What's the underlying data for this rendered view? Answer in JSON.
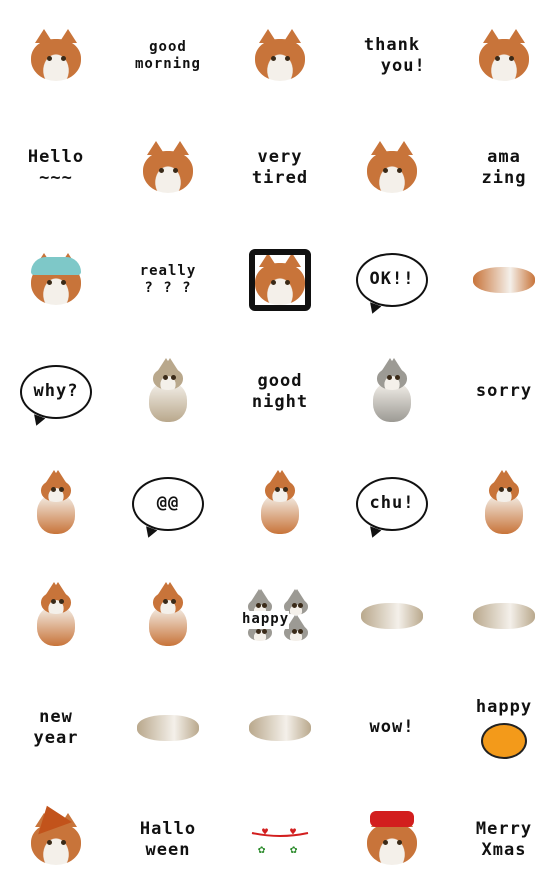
{
  "colors": {
    "orange": "#c8743a",
    "white": "#f4f0ea",
    "tabby": "#b9a88c",
    "grey": "#9c9a94",
    "pumpkin": "#f39a1a",
    "bow": "#d21e1e"
  },
  "cells": [
    {
      "type": "cat",
      "variant": "head",
      "color": "orange"
    },
    {
      "type": "text",
      "text": "good\nmorning",
      "small": true
    },
    {
      "type": "cat",
      "variant": "head",
      "color": "orange"
    },
    {
      "type": "text",
      "text": "thank\n  you!"
    },
    {
      "type": "cat",
      "variant": "head",
      "color": "orange"
    },
    {
      "type": "text",
      "text": "Hello\n~~~"
    },
    {
      "type": "cat",
      "variant": "head",
      "color": "orange"
    },
    {
      "type": "text",
      "text": "very\ntired"
    },
    {
      "type": "cat",
      "variant": "head",
      "color": "orange"
    },
    {
      "type": "text",
      "text": "ama\nzing"
    },
    {
      "type": "cat",
      "variant": "hat-knit",
      "color": "orange"
    },
    {
      "type": "text",
      "text": "really\n? ? ?",
      "small": true
    },
    {
      "type": "cat",
      "variant": "car",
      "color": "orange"
    },
    {
      "type": "bubble",
      "text": "OK!!"
    },
    {
      "type": "cat",
      "variant": "lying",
      "color": "orange"
    },
    {
      "type": "bubble",
      "text": "why?"
    },
    {
      "type": "cat",
      "variant": "sitting",
      "color": "tabby"
    },
    {
      "type": "text",
      "text": "good\nnight"
    },
    {
      "type": "cat",
      "variant": "sitting",
      "color": "grey"
    },
    {
      "type": "text",
      "text": "sorry"
    },
    {
      "type": "cat",
      "variant": "body",
      "color": "orange"
    },
    {
      "type": "bubble",
      "text": "@@"
    },
    {
      "type": "cat",
      "variant": "body",
      "color": "orange"
    },
    {
      "type": "bubble",
      "text": "chu!"
    },
    {
      "type": "cat",
      "variant": "body",
      "color": "orange"
    },
    {
      "type": "cat",
      "variant": "body",
      "color": "orange"
    },
    {
      "type": "cat",
      "variant": "body",
      "color": "orange"
    },
    {
      "type": "cat",
      "variant": "happy-grid",
      "color": "grey",
      "text": "happy"
    },
    {
      "type": "cat",
      "variant": "lying",
      "color": "tabby"
    },
    {
      "type": "cat",
      "variant": "lying",
      "color": "tabby"
    },
    {
      "type": "text",
      "text": "new\nyear"
    },
    {
      "type": "cat",
      "variant": "lying",
      "color": "tabby"
    },
    {
      "type": "cat",
      "variant": "lying",
      "color": "tabby"
    },
    {
      "type": "text",
      "text": "wow!"
    },
    {
      "type": "pumpkin",
      "text": "happy"
    },
    {
      "type": "cat",
      "variant": "witch",
      "color": "orange"
    },
    {
      "type": "text",
      "text": "Hallo\nween"
    },
    {
      "type": "garland"
    },
    {
      "type": "cat",
      "variant": "bow",
      "color": "orange"
    },
    {
      "type": "text",
      "text": "Merry\nXmas"
    }
  ]
}
